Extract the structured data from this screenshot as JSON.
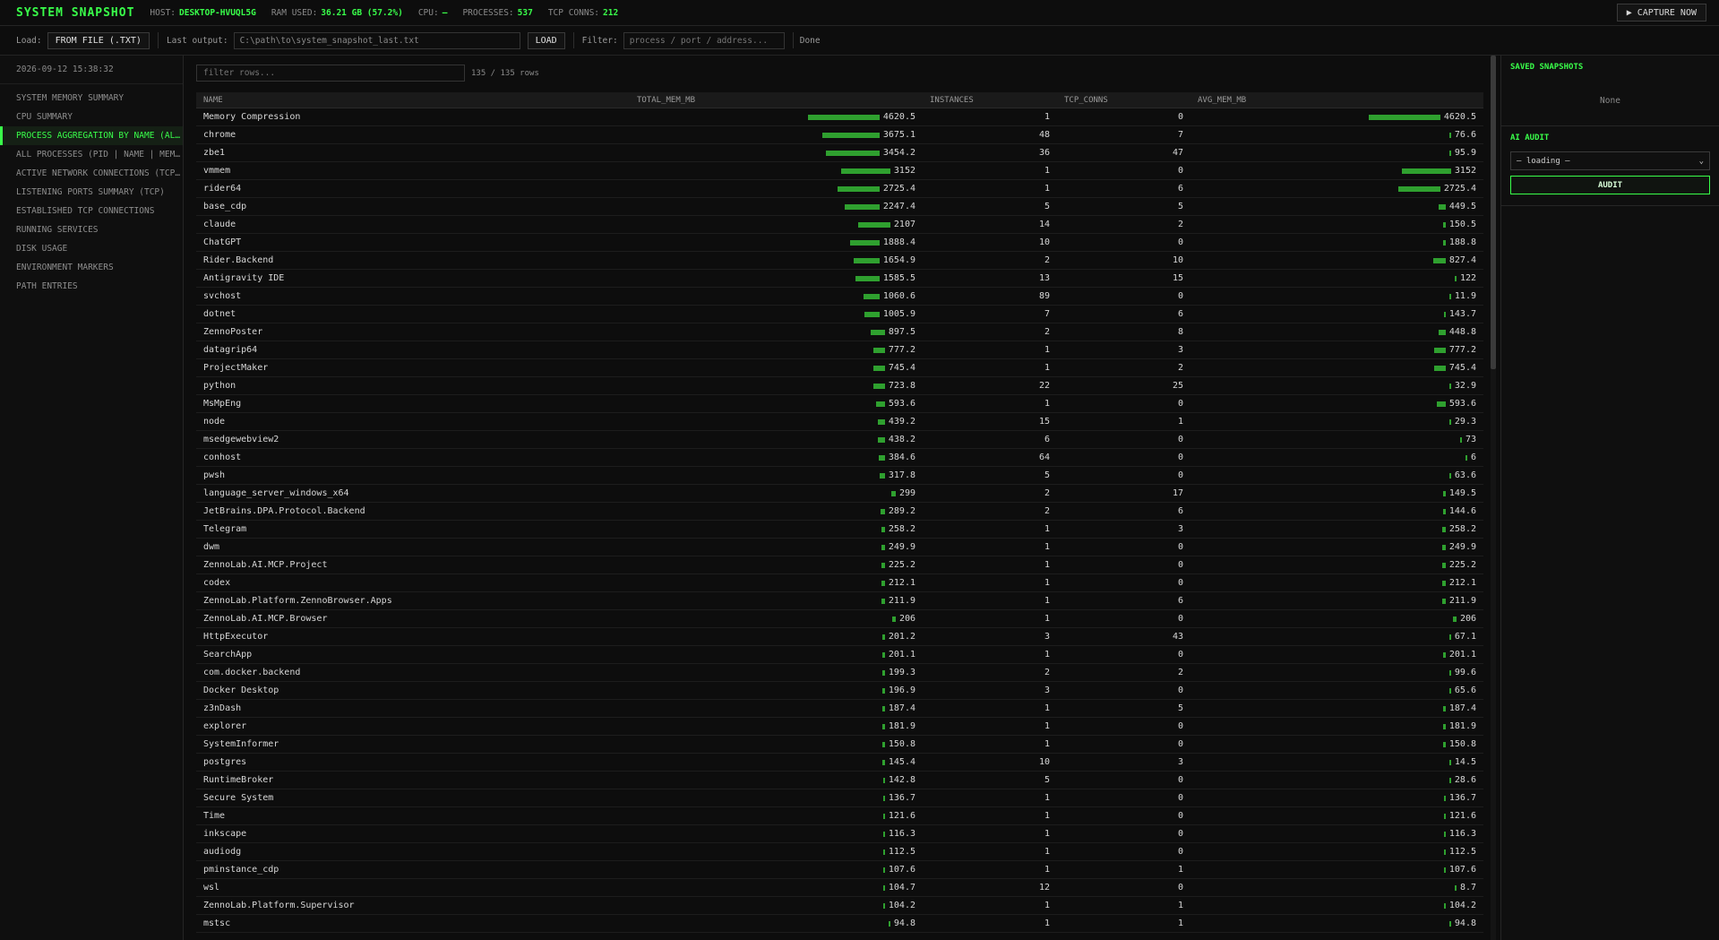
{
  "header": {
    "title": "SYSTEM SNAPSHOT",
    "host_label": "HOST:",
    "host_value": "DESKTOP-HVUQL5G",
    "ram_label": "RAM USED:",
    "ram_value": "36.21 GB (57.2%)",
    "cpu_label": "CPU:",
    "cpu_value": "—",
    "proc_label": "PROCESSES:",
    "proc_value": "537",
    "tcp_label": "TCP CONNS:",
    "tcp_value": "212",
    "capture_label": "▶ CAPTURE NOW"
  },
  "toolbar": {
    "load_label": "Load:",
    "from_file_label": "FROM FILE (.TXT)",
    "last_output_label": "Last output:",
    "last_output_value": "C:\\path\\to\\system_snapshot_last.txt",
    "load_button_label": "LOAD",
    "filter_label": "Filter:",
    "filter_placeholder": "process / port / address...",
    "status": "Done"
  },
  "sidebar": {
    "date": "2026-09-12 15:38:32",
    "items": [
      {
        "label": "SYSTEM MEMORY SUMMARY"
      },
      {
        "label": "CPU SUMMARY"
      },
      {
        "label": "PROCESS AGGREGATION BY NAME (ALL PROCESSES)"
      },
      {
        "label": "ALL PROCESSES (PID | NAME | MEM_MB)"
      },
      {
        "label": "ACTIVE NETWORK CONNECTIONS (TCP ESTABLISHED)"
      },
      {
        "label": "LISTENING PORTS SUMMARY (TCP)"
      },
      {
        "label": "ESTABLISHED TCP CONNECTIONS"
      },
      {
        "label": "RUNNING SERVICES"
      },
      {
        "label": "DISK USAGE"
      },
      {
        "label": "ENVIRONMENT MARKERS"
      },
      {
        "label": "PATH ENTRIES"
      }
    ]
  },
  "main": {
    "filter_placeholder": "filter rows...",
    "row_count": "135 / 135 rows",
    "columns": [
      "NAME",
      "TOTAL_MEM_MB",
      "INSTANCES",
      "TCP_CONNS",
      "AVG_MEM_MB"
    ],
    "rows": [
      {
        "name": "Memory Compression",
        "total": "4620.5",
        "instances": "1",
        "tcp": "0",
        "avg": "4620.5"
      },
      {
        "name": "chrome",
        "total": "3675.1",
        "instances": "48",
        "tcp": "7",
        "avg": "76.6"
      },
      {
        "name": "zbe1",
        "total": "3454.2",
        "instances": "36",
        "tcp": "47",
        "avg": "95.9"
      },
      {
        "name": "vmmem",
        "total": "3152",
        "instances": "1",
        "tcp": "0",
        "avg": "3152"
      },
      {
        "name": "rider64",
        "total": "2725.4",
        "instances": "1",
        "tcp": "6",
        "avg": "2725.4"
      },
      {
        "name": "base_cdp",
        "total": "2247.4",
        "instances": "5",
        "tcp": "5",
        "avg": "449.5"
      },
      {
        "name": "claude",
        "total": "2107",
        "instances": "14",
        "tcp": "2",
        "avg": "150.5"
      },
      {
        "name": "ChatGPT",
        "total": "1888.4",
        "instances": "10",
        "tcp": "0",
        "avg": "188.8"
      },
      {
        "name": "Rider.Backend",
        "total": "1654.9",
        "instances": "2",
        "tcp": "10",
        "avg": "827.4"
      },
      {
        "name": "Antigravity IDE",
        "total": "1585.5",
        "instances": "13",
        "tcp": "15",
        "avg": "122"
      },
      {
        "name": "svchost",
        "total": "1060.6",
        "instances": "89",
        "tcp": "0",
        "avg": "11.9"
      },
      {
        "name": "dotnet",
        "total": "1005.9",
        "instances": "7",
        "tcp": "6",
        "avg": "143.7"
      },
      {
        "name": "ZennoPoster",
        "total": "897.5",
        "instances": "2",
        "tcp": "8",
        "avg": "448.8"
      },
      {
        "name": "datagrip64",
        "total": "777.2",
        "instances": "1",
        "tcp": "3",
        "avg": "777.2"
      },
      {
        "name": "ProjectMaker",
        "total": "745.4",
        "instances": "1",
        "tcp": "2",
        "avg": "745.4"
      },
      {
        "name": "python",
        "total": "723.8",
        "instances": "22",
        "tcp": "25",
        "avg": "32.9"
      },
      {
        "name": "MsMpEng",
        "total": "593.6",
        "instances": "1",
        "tcp": "0",
        "avg": "593.6"
      },
      {
        "name": "node",
        "total": "439.2",
        "instances": "15",
        "tcp": "1",
        "avg": "29.3"
      },
      {
        "name": "msedgewebview2",
        "total": "438.2",
        "instances": "6",
        "tcp": "0",
        "avg": "73"
      },
      {
        "name": "conhost",
        "total": "384.6",
        "instances": "64",
        "tcp": "0",
        "avg": "6"
      },
      {
        "name": "pwsh",
        "total": "317.8",
        "instances": "5",
        "tcp": "0",
        "avg": "63.6"
      },
      {
        "name": "language_server_windows_x64",
        "total": "299",
        "instances": "2",
        "tcp": "17",
        "avg": "149.5"
      },
      {
        "name": "JetBrains.DPA.Protocol.Backend",
        "total": "289.2",
        "instances": "2",
        "tcp": "6",
        "avg": "144.6"
      },
      {
        "name": "Telegram",
        "total": "258.2",
        "instances": "1",
        "tcp": "3",
        "avg": "258.2"
      },
      {
        "name": "dwm",
        "total": "249.9",
        "instances": "1",
        "tcp": "0",
        "avg": "249.9"
      },
      {
        "name": "ZennoLab.AI.MCP.Project",
        "total": "225.2",
        "instances": "1",
        "tcp": "0",
        "avg": "225.2"
      },
      {
        "name": "codex",
        "total": "212.1",
        "instances": "1",
        "tcp": "0",
        "avg": "212.1"
      },
      {
        "name": "ZennoLab.Platform.ZennoBrowser.Apps",
        "total": "211.9",
        "instances": "1",
        "tcp": "6",
        "avg": "211.9"
      },
      {
        "name": "ZennoLab.AI.MCP.Browser",
        "total": "206",
        "instances": "1",
        "tcp": "0",
        "avg": "206"
      },
      {
        "name": "HttpExecutor",
        "total": "201.2",
        "instances": "3",
        "tcp": "43",
        "avg": "67.1"
      },
      {
        "name": "SearchApp",
        "total": "201.1",
        "instances": "1",
        "tcp": "0",
        "avg": "201.1"
      },
      {
        "name": "com.docker.backend",
        "total": "199.3",
        "instances": "2",
        "tcp": "2",
        "avg": "99.6"
      },
      {
        "name": "Docker Desktop",
        "total": "196.9",
        "instances": "3",
        "tcp": "0",
        "avg": "65.6"
      },
      {
        "name": "z3nDash",
        "total": "187.4",
        "instances": "1",
        "tcp": "5",
        "avg": "187.4"
      },
      {
        "name": "explorer",
        "total": "181.9",
        "instances": "1",
        "tcp": "0",
        "avg": "181.9"
      },
      {
        "name": "SystemInformer",
        "total": "150.8",
        "instances": "1",
        "tcp": "0",
        "avg": "150.8"
      },
      {
        "name": "postgres",
        "total": "145.4",
        "instances": "10",
        "tcp": "3",
        "avg": "14.5"
      },
      {
        "name": "RuntimeBroker",
        "total": "142.8",
        "instances": "5",
        "tcp": "0",
        "avg": "28.6"
      },
      {
        "name": "Secure System",
        "total": "136.7",
        "instances": "1",
        "tcp": "0",
        "avg": "136.7"
      },
      {
        "name": "Time",
        "total": "121.6",
        "instances": "1",
        "tcp": "0",
        "avg": "121.6"
      },
      {
        "name": "inkscape",
        "total": "116.3",
        "instances": "1",
        "tcp": "0",
        "avg": "116.3"
      },
      {
        "name": "audiodg",
        "total": "112.5",
        "instances": "1",
        "tcp": "0",
        "avg": "112.5"
      },
      {
        "name": "pminstance_cdp",
        "total": "107.6",
        "instances": "1",
        "tcp": "1",
        "avg": "107.6"
      },
      {
        "name": "wsl",
        "total": "104.7",
        "instances": "12",
        "tcp": "0",
        "avg": "8.7"
      },
      {
        "name": "ZennoLab.Platform.Supervisor",
        "total": "104.2",
        "instances": "1",
        "tcp": "1",
        "avg": "104.2"
      },
      {
        "name": "mstsc",
        "total": "94.8",
        "instances": "1",
        "tcp": "1",
        "avg": "94.8"
      }
    ]
  },
  "rightpanel": {
    "saved_title": "SAVED SNAPSHOTS",
    "saved_empty": "None",
    "audit_title": "AI AUDIT",
    "audit_select": "— loading —",
    "audit_button": "AUDIT"
  },
  "colors": {
    "accent": "#39ff4a",
    "bar": "#2fa02f",
    "background": "#0d0d0d"
  }
}
